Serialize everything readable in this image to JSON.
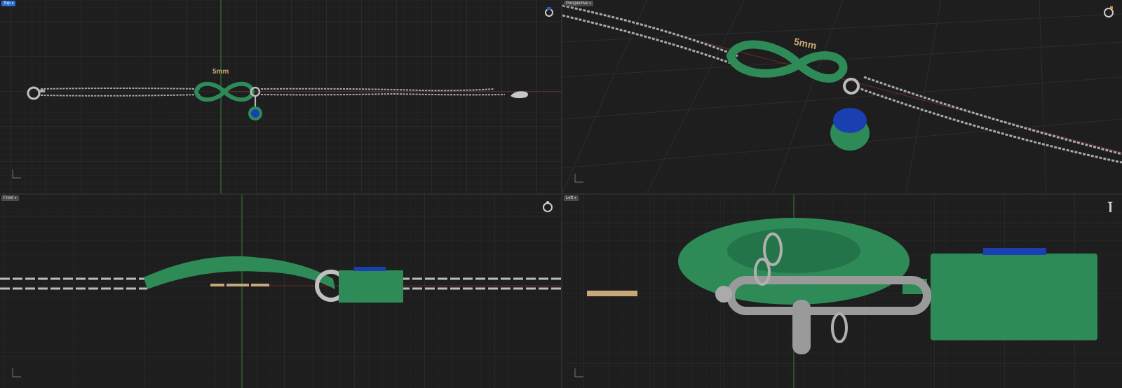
{
  "viewports": {
    "top": {
      "label": "Top",
      "dim_text": "5mm"
    },
    "perspective": {
      "label": "Perspective",
      "dim_text": "5mm"
    },
    "front": {
      "label": "Front"
    },
    "left": {
      "label": "Left"
    }
  },
  "colors": {
    "background": "#1e1e1e",
    "grid": "#2e2e2e",
    "grid_major": "#3a3a3a",
    "green_axis": "#3d9a3d",
    "red_axis": "#8a2a2a",
    "metal": "#b8b8b8",
    "pendant_green": "#2e8b57",
    "stone_blue": "#1a3fb0",
    "gold_text": "#c9a878",
    "active_tab": "#2b6fd6"
  },
  "icons": [
    "viewport-menu-chevron-icon",
    "ring-gizmo-icon",
    "axis-triad-icon"
  ]
}
